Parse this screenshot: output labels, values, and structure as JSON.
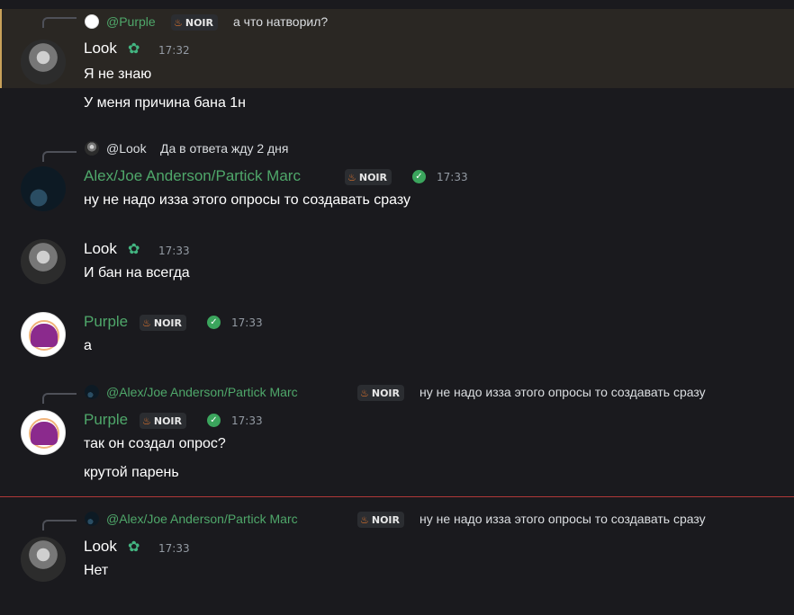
{
  "badge_label": "NOIR",
  "colors": {
    "green_name": "#4fa76a",
    "highlight": "#2a2723",
    "divider": "#b13838"
  },
  "messages": [
    {
      "reply": {
        "author": "@Purple",
        "text": "а что натворил?"
      },
      "author": "Look",
      "time": "17:32",
      "lines": [
        "Я не знаю",
        "У меня причина бана 1н"
      ]
    },
    {
      "reply": {
        "author": "@Look",
        "text": "Да в ответа жду 2 дня"
      },
      "author": "Alex/Joe Anderson/Partick Marc",
      "time": "17:33",
      "lines": [
        "ну не надо изза этого опросы то создавать сразу"
      ]
    },
    {
      "author": "Look",
      "time": "17:33",
      "lines": [
        "И бан на всегда"
      ]
    },
    {
      "author": "Purple",
      "time": "17:33",
      "lines": [
        "а"
      ]
    },
    {
      "reply": {
        "author": "@Alex/Joe Anderson/Partick Marc",
        "text": "ну не надо изза этого опросы то создавать сразу"
      },
      "author": "Purple",
      "time": "17:33",
      "lines": [
        "так он создал опрос?",
        "крутой парень"
      ]
    },
    {
      "reply": {
        "author": "@Alex/Joe Anderson/Partick Marc",
        "text": "ну не надо изза этого опросы то создавать сразу"
      },
      "author": "Look",
      "time": "17:33",
      "lines": [
        "Нет"
      ]
    }
  ],
  "icons": {
    "leaf": "leaf-icon",
    "verified": "verified-check-icon",
    "flame": "flame-icon",
    "reply": "reply-spine-icon"
  }
}
